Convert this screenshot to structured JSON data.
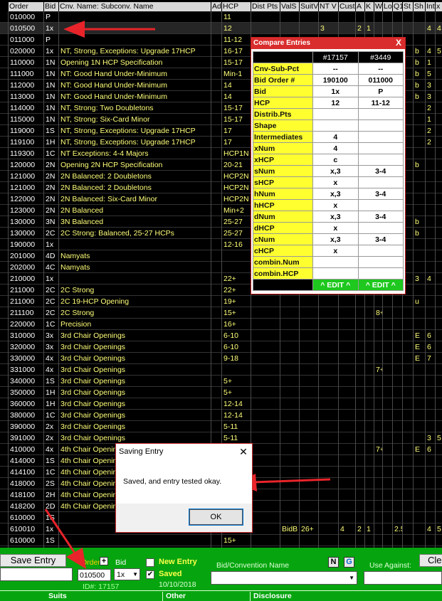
{
  "grid": {
    "headers": [
      "Order",
      "Bid",
      "Cnv. Name: Subconv. Name",
      "Ad",
      "HCP",
      "Dist Pts",
      "ValS",
      "SuitV",
      "NT V",
      "Cust",
      "A",
      "K",
      "W",
      "Lo",
      "Q1",
      "St",
      "Sh",
      "Int",
      "x"
    ],
    "rows": [
      {
        "order": "010000",
        "bid": "P",
        "name": "",
        "hcp": "11",
        "extra": []
      },
      {
        "order": "010500",
        "bid": "1x",
        "name": "",
        "hcp": "12",
        "extra": [
          {
            "c": 8,
            "v": "3"
          },
          {
            "c": 10,
            "v": "2"
          },
          {
            "c": 11,
            "v": "1"
          },
          {
            "c": 17,
            "v": "4"
          },
          {
            "c": 18,
            "v": "4"
          }
        ]
      },
      {
        "order": "011000",
        "bid": "P",
        "name": "",
        "hcp": "11-12",
        "extra": []
      },
      {
        "order": "020000",
        "bid": "1x",
        "name": "NT, Strong, Exceptions: Upgrade 17HCP",
        "hcp": "16-17",
        "extra": [
          {
            "c": 16,
            "v": "b"
          },
          {
            "c": 17,
            "v": "4"
          },
          {
            "c": 18,
            "v": "5"
          }
        ]
      },
      {
        "order": "110000",
        "bid": "1N",
        "name": "Opening 1N HCP Specification",
        "hcp": "15-17",
        "extra": [
          {
            "c": 16,
            "v": "b"
          },
          {
            "c": 17,
            "v": "1"
          }
        ]
      },
      {
        "order": "111000",
        "bid": "1N",
        "name": "NT: Good Hand Under-Minimum",
        "hcp": "Min-1",
        "extra": [
          {
            "c": 16,
            "v": "b"
          },
          {
            "c": 17,
            "v": "5"
          }
        ]
      },
      {
        "order": "112000",
        "bid": "1N",
        "name": "NT: Good Hand Under-Minimum",
        "hcp": "14",
        "extra": [
          {
            "c": 16,
            "v": "b"
          },
          {
            "c": 17,
            "v": "3"
          }
        ]
      },
      {
        "order": "113000",
        "bid": "1N",
        "name": "NT: Good Hand Under-Minimum",
        "hcp": "14",
        "extra": [
          {
            "c": 16,
            "v": "b"
          },
          {
            "c": 17,
            "v": "3"
          }
        ]
      },
      {
        "order": "114000",
        "bid": "1N",
        "name": "NT, Strong: Two Doubletons",
        "hcp": "15-17",
        "extra": [
          {
            "c": 17,
            "v": "2"
          }
        ]
      },
      {
        "order": "115000",
        "bid": "1N",
        "name": "NT, Strong: Six-Card Minor",
        "hcp": "15-17",
        "extra": [
          {
            "c": 17,
            "v": "1"
          }
        ]
      },
      {
        "order": "119000",
        "bid": "1S",
        "name": "NT, Strong, Exceptions: Upgrade 17HCP",
        "hcp": "17",
        "extra": [
          {
            "c": 17,
            "v": "2"
          }
        ]
      },
      {
        "order": "119100",
        "bid": "1H",
        "name": "NT, Strong, Exceptions: Upgrade 17HCP",
        "hcp": "17",
        "extra": [
          {
            "c": 17,
            "v": "2"
          }
        ]
      },
      {
        "order": "119300",
        "bid": "1C",
        "name": "NT Exceptions: 4-4 Majors",
        "hcp": "HCP1N",
        "extra": []
      },
      {
        "order": "120000",
        "bid": "2N",
        "name": "Opening 2N HCP Specification",
        "hcp": "20-21",
        "extra": [
          {
            "c": 16,
            "v": "b"
          }
        ]
      },
      {
        "order": "121000",
        "bid": "2N",
        "name": "2N Balanced: 2 Doubletons",
        "hcp": "HCP2N",
        "extra": []
      },
      {
        "order": "121000",
        "bid": "2N",
        "name": "2N Balanced: 2 Doubletons",
        "hcp": "HCP2N",
        "extra": []
      },
      {
        "order": "122000",
        "bid": "2N",
        "name": "2N Balanced: Six-Card Minor",
        "hcp": "HCP2N",
        "extra": []
      },
      {
        "order": "123000",
        "bid": "2N",
        "name": "2N Balanced",
        "hcp": "Min+2",
        "extra": []
      },
      {
        "order": "130000",
        "bid": "3N",
        "name": "3N Balanced",
        "hcp": "25-27",
        "extra": [
          {
            "c": 16,
            "v": "b"
          }
        ]
      },
      {
        "order": "130000",
        "bid": "2C",
        "name": "2C Strong: Balanced, 25-27 HCPs",
        "hcp": "25-27",
        "extra": [
          {
            "c": 16,
            "v": "b"
          }
        ]
      },
      {
        "order": "190000",
        "bid": "1x",
        "name": "",
        "hcp": "12-16",
        "extra": []
      },
      {
        "order": "201000",
        "bid": "4D",
        "name": "Namyats",
        "hcp": "",
        "extra": []
      },
      {
        "order": "202000",
        "bid": "4C",
        "name": "Namyats",
        "hcp": "",
        "extra": []
      },
      {
        "order": "210000",
        "bid": "1x",
        "name": "",
        "hcp": "22+",
        "extra": [
          {
            "c": 16,
            "v": "3"
          },
          {
            "c": 17,
            "v": "4"
          }
        ]
      },
      {
        "order": "211000",
        "bid": "2C",
        "name": "2C Strong",
        "hcp": "22+",
        "extra": []
      },
      {
        "order": "211000",
        "bid": "2C",
        "name": "2C 19-HCP Opening",
        "hcp": "19+",
        "extra": [
          {
            "c": 16,
            "v": "u"
          }
        ]
      },
      {
        "order": "211100",
        "bid": "2C",
        "name": "2C Strong",
        "hcp": "15+",
        "extra": [
          {
            "c": 12,
            "v": "8+"
          }
        ]
      },
      {
        "order": "220000",
        "bid": "1C",
        "name": "Precision",
        "hcp": "16+",
        "extra": []
      },
      {
        "order": "310000",
        "bid": "3x",
        "name": "3rd Chair Openings",
        "hcp": "6-10",
        "extra": [
          {
            "c": 16,
            "v": "E"
          },
          {
            "c": 17,
            "v": "6"
          }
        ]
      },
      {
        "order": "320000",
        "bid": "3x",
        "name": "3rd Chair Openings",
        "hcp": "6-10",
        "extra": [
          {
            "c": 16,
            "v": "E"
          },
          {
            "c": 17,
            "v": "6"
          }
        ]
      },
      {
        "order": "330000",
        "bid": "4x",
        "name": "3rd Chair Openings",
        "hcp": "9-18",
        "extra": [
          {
            "c": 16,
            "v": "E"
          },
          {
            "c": 17,
            "v": "7"
          }
        ]
      },
      {
        "order": "331000",
        "bid": "4x",
        "name": "3rd Chair Openings",
        "hcp": "",
        "extra": [
          {
            "c": 12,
            "v": "7+"
          }
        ]
      },
      {
        "order": "340000",
        "bid": "1S",
        "name": "3rd Chair Openings",
        "hcp": "5+",
        "extra": []
      },
      {
        "order": "350000",
        "bid": "1H",
        "name": "3rd Chair Openings",
        "hcp": "5+",
        "extra": []
      },
      {
        "order": "360000",
        "bid": "1H",
        "name": "3rd Chair Openings",
        "hcp": "12-14",
        "extra": []
      },
      {
        "order": "380000",
        "bid": "1C",
        "name": "3rd Chair Openings",
        "hcp": "12-14",
        "extra": []
      },
      {
        "order": "390000",
        "bid": "2x",
        "name": "3rd Chair Openings",
        "hcp": "5-11",
        "extra": []
      },
      {
        "order": "391000",
        "bid": "2x",
        "name": "3rd Chair Openings",
        "hcp": "5-11",
        "extra": [
          {
            "c": 17,
            "v": "3"
          },
          {
            "c": 18,
            "v": "5"
          }
        ]
      },
      {
        "order": "410000",
        "bid": "4x",
        "name": "4th Chair Openings",
        "hcp": "",
        "extra": [
          {
            "c": 12,
            "v": "7+"
          },
          {
            "c": 16,
            "v": "E"
          },
          {
            "c": 17,
            "v": "6"
          }
        ]
      },
      {
        "order": "414000",
        "bid": "1S",
        "name": "4th Chair Openin",
        "hcp": "",
        "extra": []
      },
      {
        "order": "414100",
        "bid": "1C",
        "name": "4th Chair Openin",
        "hcp": "",
        "extra": []
      },
      {
        "order": "418000",
        "bid": "2S",
        "name": "4th Chair Openin",
        "hcp": "",
        "extra": []
      },
      {
        "order": "418100",
        "bid": "2H",
        "name": "4th Chair Openin",
        "hcp": "",
        "extra": []
      },
      {
        "order": "418200",
        "bid": "2D",
        "name": "4th Chair Openin",
        "hcp": "",
        "extra": []
      },
      {
        "order": "610000",
        "bid": "1S",
        "name": "",
        "hcp": "",
        "extra": []
      },
      {
        "order": "610010",
        "bid": "1x",
        "name": "",
        "hcp": "",
        "extra": [
          {
            "c": 6,
            "v": "BidB"
          },
          {
            "c": 7,
            "v": "26+"
          },
          {
            "c": 9,
            "v": "4"
          },
          {
            "c": 10,
            "v": "2"
          },
          {
            "c": 11,
            "v": "1"
          },
          {
            "c": 14,
            "v": "2.5"
          },
          {
            "c": 17,
            "v": "4"
          },
          {
            "c": 18,
            "v": "5"
          }
        ]
      },
      {
        "order": "610000",
        "bid": "1S",
        "name": "",
        "hcp": "15+",
        "extra": []
      }
    ]
  },
  "compare": {
    "title": "Compare Entries",
    "close": "X",
    "col1_header": "#17157",
    "col2_header": "#3449",
    "rows": [
      {
        "label": "Cnv-Sub-Pct",
        "a": "--",
        "b": "--"
      },
      {
        "label": "Bid Order #",
        "a": "190100",
        "b": "011000"
      },
      {
        "label": "Bid",
        "a": "1x",
        "b": "P"
      },
      {
        "label": "HCP",
        "a": "12",
        "b": "11-12"
      },
      {
        "label": "Distrib.Pts",
        "a": "",
        "b": ""
      },
      {
        "label": "Shape",
        "a": "",
        "b": ""
      },
      {
        "label": "Intermediates",
        "a": "4",
        "b": ""
      },
      {
        "label": "xNum",
        "a": "4",
        "b": ""
      },
      {
        "label": "xHCP",
        "a": "c",
        "b": ""
      },
      {
        "label": "sNum",
        "a": "x,3",
        "b": "3-4"
      },
      {
        "label": "sHCP",
        "a": "x",
        "b": ""
      },
      {
        "label": "hNum",
        "a": "x,3",
        "b": "3-4"
      },
      {
        "label": "hHCP",
        "a": "x",
        "b": ""
      },
      {
        "label": "dNum",
        "a": "x,3",
        "b": "3-4"
      },
      {
        "label": "dHCP",
        "a": "x",
        "b": ""
      },
      {
        "label": "cNum",
        "a": "x,3",
        "b": "3-4"
      },
      {
        "label": "cHCP",
        "a": "x",
        "b": ""
      },
      {
        "label": "combin.Num",
        "a": "",
        "b": ""
      },
      {
        "label": "combin.HCP",
        "a": "",
        "b": ""
      }
    ],
    "edit1": "^ EDIT ^",
    "edit2": "^ EDIT ^"
  },
  "dialog": {
    "title": "Saving Entry",
    "close": "✕",
    "message": "Saved, and entry tested okay.",
    "ok": "OK"
  },
  "bottom": {
    "save_entry": "Save Entry",
    "order_label": "Order:",
    "order_plus": "+",
    "order_value": "010500",
    "bid_label": "Bid",
    "bid_value": "1x",
    "id_text": "ID#: 17157",
    "new_entry": "New Entry",
    "saved": "Saved",
    "saved_date": "10/10/2018",
    "bidconv_label": "Bid/Convention Name",
    "n_button": "N",
    "g_button": "G",
    "use_against": "Use Against:",
    "clear": "Cle",
    "suits": "Suits",
    "other": "Other",
    "disclosure": "Disclosure"
  },
  "colors": {
    "arrow": "#e8242a",
    "grid_bg": "#000000",
    "panel_green": "#06a50f",
    "compare_label": "#ffff30",
    "edit_green": "#1ec81e"
  }
}
